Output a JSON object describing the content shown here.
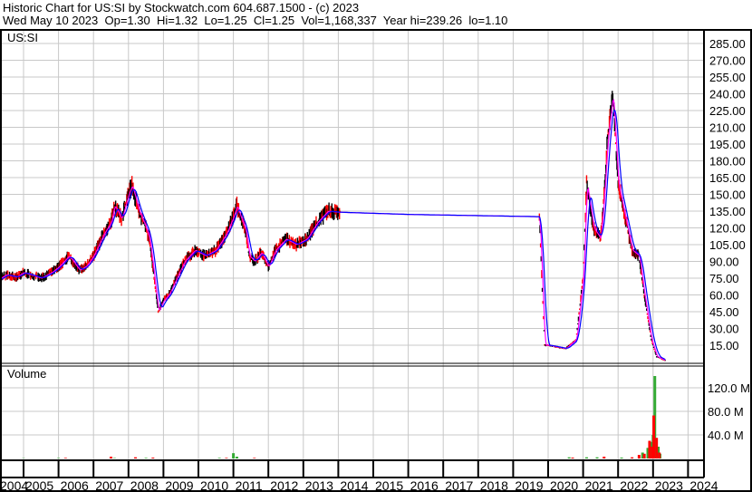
{
  "header": {
    "title": "Historic Chart for US:SI by Stockwatch.com 604.687.1500 - (c) 2023",
    "quote_line": "Wed May 10 2023  Op=1.30  Hi=1.32  Lo=1.25  Cl=1.25  Vol=1,168,337  Year hi=239.26  lo=1.10"
  },
  "chart_data": [
    {
      "type": "line",
      "title": "US:SI",
      "ylabel": "",
      "ylim": [
        0,
        295
      ],
      "yticks": [
        "285.00",
        "270.00",
        "255.00",
        "240.00",
        "225.00",
        "210.00",
        "195.00",
        "180.00",
        "165.00",
        "150.00",
        "135.00",
        "120.00",
        "105.00",
        "90.00",
        "75.00",
        "60.00",
        "45.00",
        "30.00",
        "15.00"
      ],
      "xticks": [
        "2004",
        "2005",
        "2006",
        "2007",
        "2008",
        "2009",
        "2010",
        "2011",
        "2012",
        "2013",
        "2014",
        "2015",
        "2016",
        "2017",
        "2018",
        "2019",
        "2020",
        "2021",
        "2022",
        "2023",
        "2024"
      ],
      "grid": true,
      "series": [
        {
          "name": "price",
          "color": "#000000",
          "points": [
            [
              2004.0,
              70
            ],
            [
              2004.3,
              74
            ],
            [
              2004.5,
              78
            ],
            [
              2004.8,
              76
            ],
            [
              2005.0,
              80
            ],
            [
              2005.3,
              77
            ],
            [
              2005.5,
              75
            ],
            [
              2005.8,
              80
            ],
            [
              2006.0,
              85
            ],
            [
              2006.3,
              95
            ],
            [
              2006.6,
              82
            ],
            [
              2006.8,
              86
            ],
            [
              2007.0,
              95
            ],
            [
              2007.3,
              115
            ],
            [
              2007.5,
              125
            ],
            [
              2007.6,
              140
            ],
            [
              2007.8,
              128
            ],
            [
              2008.0,
              150
            ],
            [
              2008.1,
              158
            ],
            [
              2008.3,
              135
            ],
            [
              2008.5,
              120
            ],
            [
              2008.6,
              110
            ],
            [
              2008.7,
              85
            ],
            [
              2008.85,
              45
            ],
            [
              2009.0,
              55
            ],
            [
              2009.15,
              60
            ],
            [
              2009.3,
              70
            ],
            [
              2009.6,
              90
            ],
            [
              2009.9,
              100
            ],
            [
              2010.2,
              95
            ],
            [
              2010.5,
              100
            ],
            [
              2010.8,
              115
            ],
            [
              2011.0,
              130
            ],
            [
              2011.1,
              140
            ],
            [
              2011.2,
              130
            ],
            [
              2011.35,
              118
            ],
            [
              2011.45,
              95
            ],
            [
              2011.6,
              90
            ],
            [
              2011.8,
              98
            ],
            [
              2012.0,
              85
            ],
            [
              2012.2,
              100
            ],
            [
              2012.5,
              110
            ],
            [
              2012.8,
              105
            ],
            [
              2013.1,
              110
            ],
            [
              2013.4,
              125
            ],
            [
              2013.7,
              135
            ],
            [
              2014.0,
              134
            ],
            [
              2016.0,
              132
            ],
            [
              2019.75,
              130
            ],
            [
              2019.9,
              15
            ],
            [
              2020.0,
              15
            ],
            [
              2020.5,
              12
            ],
            [
              2020.8,
              20
            ],
            [
              2021.0,
              75
            ],
            [
              2021.1,
              160
            ],
            [
              2021.2,
              140
            ],
            [
              2021.3,
              120
            ],
            [
              2021.5,
              110
            ],
            [
              2021.6,
              150
            ],
            [
              2021.7,
              200
            ],
            [
              2021.85,
              240
            ],
            [
              2022.0,
              160
            ],
            [
              2022.2,
              130
            ],
            [
              2022.4,
              100
            ],
            [
              2022.6,
              95
            ],
            [
              2022.75,
              60
            ],
            [
              2022.95,
              20
            ],
            [
              2023.1,
              5
            ],
            [
              2023.35,
              1.25
            ]
          ]
        },
        {
          "name": "short-ma",
          "color": "#ff00ff"
        },
        {
          "name": "long-ma",
          "color": "#0000ff"
        }
      ]
    },
    {
      "type": "bar",
      "title": "Volume",
      "ylabel": "",
      "ylim": [
        0,
        160
      ],
      "yticks": [
        "120.0 M",
        "80.0 M",
        "40.0 M"
      ],
      "series": [
        {
          "name": "volume-up",
          "color": "#33aa33",
          "points": [
            [
              2005.0,
              0.5
            ],
            [
              2006.0,
              0.8
            ],
            [
              2007.6,
              0.8
            ],
            [
              2008.5,
              1
            ],
            [
              2010.6,
              1
            ],
            [
              2011.0,
              9
            ],
            [
              2011.1,
              3
            ],
            [
              2020.6,
              2
            ],
            [
              2021.1,
              2
            ],
            [
              2021.4,
              2
            ],
            [
              2022.1,
              1.5
            ],
            [
              2022.7,
              10
            ],
            [
              2022.85,
              18
            ],
            [
              2022.95,
              28
            ],
            [
              2023.0,
              40
            ],
            [
              2023.05,
              140
            ],
            [
              2023.15,
              20
            ],
            [
              2023.2,
              8
            ]
          ]
        },
        {
          "name": "volume-down",
          "color": "#ff0000",
          "points": [
            [
              2006.2,
              1
            ],
            [
              2007.5,
              3
            ],
            [
              2008.2,
              2
            ],
            [
              2008.7,
              1.5
            ],
            [
              2010.8,
              1
            ],
            [
              2011.6,
              1
            ],
            [
              2020.7,
              1.5
            ],
            [
              2021.6,
              3
            ],
            [
              2022.4,
              2
            ],
            [
              2022.6,
              6
            ],
            [
              2022.75,
              8
            ],
            [
              2022.9,
              30
            ],
            [
              2022.98,
              20
            ],
            [
              2023.02,
              73
            ],
            [
              2023.1,
              35
            ],
            [
              2023.18,
              10
            ]
          ]
        }
      ]
    }
  ]
}
